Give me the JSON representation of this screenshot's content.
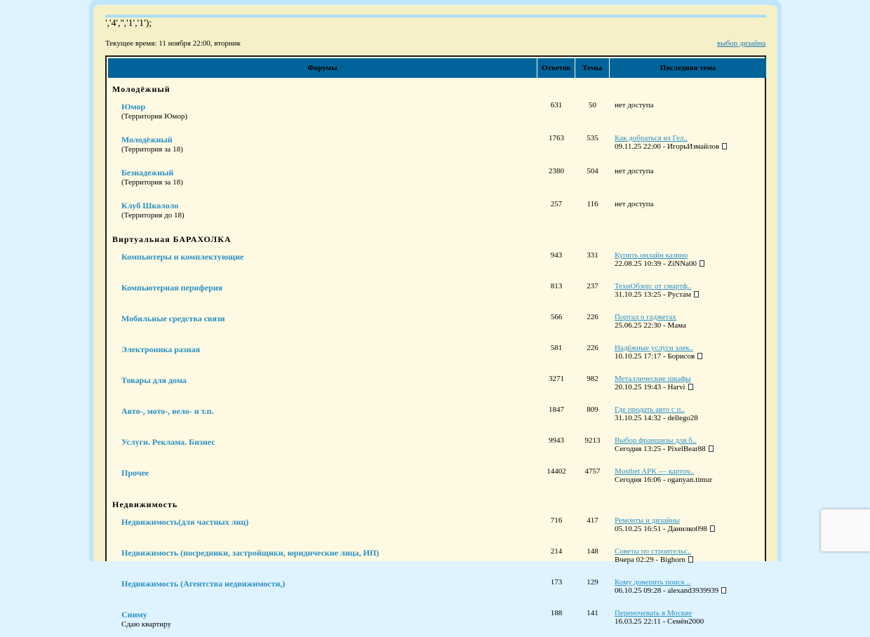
{
  "header": {
    "raw_text": "','4','','1','1');",
    "current_time": "Текущее время: 11 ноября 22:00, вторник",
    "design_link": "выбор дизайна"
  },
  "table": {
    "columns": [
      "Форумы",
      "Ответов",
      "Темы",
      "Последняя тема"
    ],
    "categories": [
      {
        "name": "Молодёжный",
        "forums": [
          {
            "name": "Юмор",
            "desc": "(Территория Юмор)",
            "replies": "631",
            "topics": "50",
            "last_title": "",
            "last_info": "нет доступа",
            "icon": false
          },
          {
            "name": "Молодёжный",
            "desc": "(Территория за 18)",
            "replies": "1763",
            "topics": "535",
            "last_title": "Как добраться из Гел..",
            "last_info": "09.11.25 22:00 - ИгорьИзмайлов",
            "icon": true
          },
          {
            "name": "Безнадежный",
            "desc": "(Территория за 18)",
            "replies": "2380",
            "topics": "504",
            "last_title": "",
            "last_info": "нет доступа",
            "icon": false
          },
          {
            "name": "Клуб Школоло",
            "desc": "(Территория до 18)",
            "replies": "257",
            "topics": "116",
            "last_title": "",
            "last_info": "нет доступа",
            "icon": false
          }
        ]
      },
      {
        "name": "Виртуальная БАРАХОЛКА",
        "forums": [
          {
            "name": "Компьютеры и комплектующие",
            "desc": "",
            "replies": "943",
            "topics": "331",
            "last_title": "Купить онлайн казино",
            "last_info": "22.08.25 10:39 - ZiNNa00",
            "icon": true
          },
          {
            "name": "Компьютерная периферия",
            "desc": "",
            "replies": "813",
            "topics": "237",
            "last_title": "ТехнОбзор: от смартф..",
            "last_info": "31.10.25 13:25 - Рустам",
            "icon": true
          },
          {
            "name": "Мобильные средства связи",
            "desc": "",
            "replies": "566",
            "topics": "226",
            "last_title": "Портал о гаджетах",
            "last_info": "25.06.25 22:30 - Мама",
            "icon": false
          },
          {
            "name": "Электроника разная",
            "desc": "",
            "replies": "581",
            "topics": "226",
            "last_title": "Надёжные услуги элек..",
            "last_info": "10.10.25 17:17 - Борисов",
            "icon": true
          },
          {
            "name": "Товары для дома",
            "desc": "",
            "replies": "3271",
            "topics": "982",
            "last_title": "Металлические шкафы",
            "last_info": "20.10.25 19:43 - Harvi",
            "icon": true
          },
          {
            "name": "Авто-, мото-, вело- и т.п.",
            "desc": "",
            "replies": "1847",
            "topics": "809",
            "last_title": "Где продать авто с п..",
            "last_info": "31.10.25 14:32 - dellego28",
            "icon": false
          },
          {
            "name": "Услуги. Реклама. Бизнес",
            "desc": "",
            "replies": "9943",
            "topics": "9213",
            "last_title": "Выбор франшизы для б..",
            "last_info": "Сегодня 13:25 - PixelBear88",
            "icon": true
          },
          {
            "name": "Прочее",
            "desc": "",
            "replies": "14402",
            "topics": "4757",
            "last_title": "Mostbet APK — карточ..",
            "last_info": "Сегодня 16:06 - oganyan.timur",
            "icon": false
          }
        ]
      },
      {
        "name": "Недвижимость",
        "forums": [
          {
            "name": "Недвижимость(для частных лиц)",
            "desc": "",
            "replies": "716",
            "topics": "417",
            "last_title": "Ремонты и дизайны",
            "last_info": "05.10.25 16:51 - Данилко098",
            "icon": true
          },
          {
            "name": "Недвижимость (посредники, застройщики, юридические лица, ИП)",
            "desc": "",
            "replies": "214",
            "topics": "148",
            "last_title": "Советы по строительс..",
            "last_info": "Вчера 02:29 - Bighorn",
            "icon": true
          },
          {
            "name": "Недвижимость (Агентства недвижимости,)",
            "desc": "",
            "replies": "173",
            "topics": "129",
            "last_title": "Кому доверить поиск ..",
            "last_info": "06.10.25 09:28 - alexand3939939",
            "icon": true
          },
          {
            "name": "Сниму",
            "desc": "Сдаю квартиру",
            "replies": "188",
            "topics": "141",
            "last_title": "Переночевать в Москве",
            "last_info": "16.03.25 22:11 - Семён2000",
            "icon": false
          }
        ]
      }
    ]
  }
}
